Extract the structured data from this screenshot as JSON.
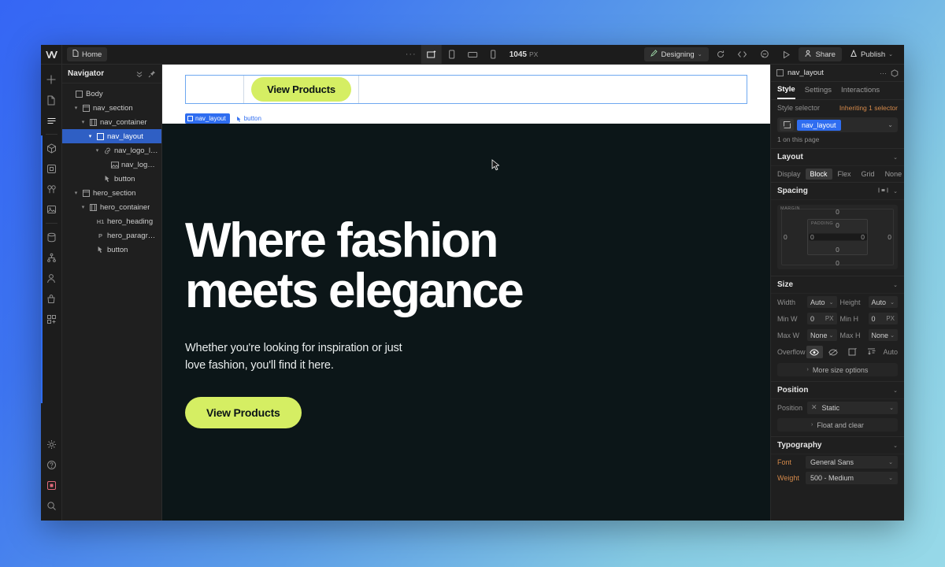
{
  "app": {
    "logo_icon": "webflow-logo-icon",
    "page_tab": "Home",
    "page_tab_icon": "page-icon",
    "overflow_dots": "···",
    "viewport_icons": [
      "desktop-icon",
      "tablet-icon",
      "mobile-landscape-icon",
      "mobile-portrait-icon"
    ],
    "viewport_width": "1045",
    "viewport_unit": "PX",
    "mode_label": "Designing",
    "mode_icon": "pencil-icon",
    "toolbar_icons": [
      "refresh-icon",
      "code-icon",
      "comment-icon",
      "preview-play-icon"
    ],
    "share_label": "Share",
    "share_icon": "person-share-icon",
    "publish_label": "Publish",
    "publish_icon": "rocket-icon",
    "caret": "⌄"
  },
  "rail": {
    "top_icons": [
      "add-icon",
      "pages-icon",
      "navigator-list-icon"
    ],
    "group_icons": [
      "components-icon",
      "assets-variables-icon",
      "variables-icon",
      "images-icon",
      "cms-database-icon",
      "logic-flow-icon",
      "users-icon",
      "ecommerce-icon",
      "apps-icon"
    ],
    "bottom_icons": [
      "settings-gear-icon",
      "help-question-icon",
      "video-record-icon",
      "search-icon"
    ]
  },
  "navigator": {
    "title": "Navigator",
    "header_icons": [
      "collapse-all-icon",
      "pin-icon"
    ],
    "items": [
      {
        "label": "Body",
        "depth": 0,
        "icon": "body-box-icon",
        "twisty": "",
        "tag": "",
        "selected": false
      },
      {
        "label": "nav_section",
        "depth": 1,
        "icon": "section-box-icon",
        "twisty": "⌄",
        "tag": "",
        "selected": false
      },
      {
        "label": "nav_container",
        "depth": 2,
        "icon": "container-icon",
        "twisty": "⌄",
        "tag": "",
        "selected": false
      },
      {
        "label": "nav_layout",
        "depth": 3,
        "icon": "div-box-icon",
        "twisty": "⌄",
        "tag": "",
        "selected": true
      },
      {
        "label": "nav_logo_link",
        "depth": 4,
        "icon": "link-icon",
        "twisty": "⌄",
        "tag": "",
        "selected": false
      },
      {
        "label": "nav_logo_ima...",
        "depth": 5,
        "icon": "image-icon",
        "twisty": "",
        "tag": "",
        "selected": false
      },
      {
        "label": "button",
        "depth": 4,
        "icon": "button-click-icon",
        "twisty": "",
        "tag": "",
        "selected": false
      },
      {
        "label": "hero_section",
        "depth": 1,
        "icon": "section-box-icon",
        "twisty": "⌄",
        "tag": "",
        "selected": false
      },
      {
        "label": "hero_container",
        "depth": 2,
        "icon": "container-icon",
        "twisty": "⌄",
        "tag": "",
        "selected": false
      },
      {
        "label": "hero_heading",
        "depth": 3,
        "icon": "",
        "twisty": "",
        "tag": "H1",
        "selected": false
      },
      {
        "label": "hero_paragraph",
        "depth": 3,
        "icon": "",
        "twisty": "",
        "tag": "P",
        "selected": false
      },
      {
        "label": "button",
        "depth": 3,
        "icon": "button-click-icon",
        "twisty": "",
        "tag": "",
        "selected": false
      }
    ]
  },
  "canvas": {
    "nav_button_label": "View Products",
    "badge_selected": "nav_layout",
    "badge_selected_icon": "div-box-icon",
    "badge_sibling": "button",
    "badge_sibling_icon": "button-click-icon",
    "hero_heading_line1": "Where fashion",
    "hero_heading_line2": "meets elegance",
    "hero_paragraph_line1": "Whether you're looking for inspiration or just",
    "hero_paragraph_line2": "love fashion, you'll find it here.",
    "hero_button_label": "View Products",
    "accent_color": "#d5ee63",
    "hero_bg_color": "#0c1618",
    "selection_color": "#2f6df0"
  },
  "style_panel": {
    "element_name": "nav_layout",
    "element_icon": "div-box-icon",
    "head_icons": [
      "more-dots-icon",
      "component-cube-icon"
    ],
    "tabs": [
      {
        "label": "Style",
        "active": true
      },
      {
        "label": "Settings",
        "active": false
      },
      {
        "label": "Interactions",
        "active": false
      }
    ],
    "selector_label": "Style selector",
    "inheriting_text": "Inheriting 1 selector",
    "selector_chip": "nav_layout",
    "selector_icon": "div-box-icon",
    "selector_caret": "⌄",
    "on_this_page": "1 on this page",
    "layout": {
      "title": "Layout",
      "display_label": "Display",
      "options": [
        "Block",
        "Flex",
        "Grid",
        "None"
      ],
      "selected": "Block",
      "caret": "⌄"
    },
    "spacing": {
      "title": "Spacing",
      "margin_tag": "MARGIN",
      "padding_tag": "PADDING",
      "margin_top": "0",
      "margin_right": "0",
      "margin_bottom": "0",
      "margin_left": "0",
      "padding_top": "0",
      "padding_right": "0",
      "padding_bottom": "0",
      "padding_left": "0",
      "mode_icon": "spacing-mode-icon",
      "caret": "⌄"
    },
    "size": {
      "title": "Size",
      "caret": "⌄",
      "width_label": "Width",
      "width_value": "Auto",
      "height_label": "Height",
      "height_value": "Auto",
      "minw_label": "Min W",
      "minw_value": "0",
      "minw_unit": "PX",
      "minh_label": "Min H",
      "minh_value": "0",
      "minh_unit": "PX",
      "maxw_label": "Max W",
      "maxw_value": "None",
      "maxh_label": "Max H",
      "maxh_value": "None",
      "overflow_label": "Overflow",
      "overflow_icons": [
        "eye-visible-icon",
        "eye-hidden-icon",
        "scroll-icon",
        "auto-scroll-icon"
      ],
      "overflow_value": "Auto",
      "more_options": "More size options"
    },
    "position": {
      "title": "Position",
      "caret": "⌄",
      "label": "Position",
      "value": "Static",
      "clear_icon": "x-clear-icon",
      "float_and_clear": "Float and clear"
    },
    "typography": {
      "title": "Typography",
      "caret": "⌄",
      "font_label": "Font",
      "font_value": "General Sans",
      "weight_label": "Weight",
      "weight_value": "500 - Medium"
    }
  }
}
